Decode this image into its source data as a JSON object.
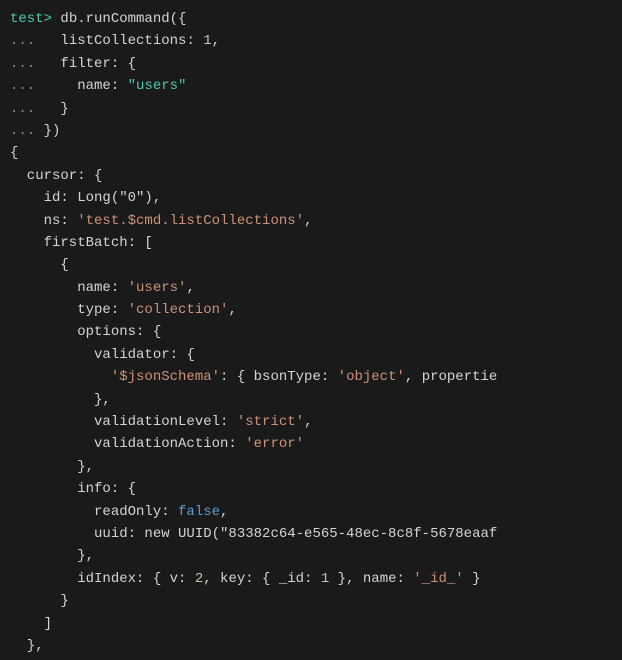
{
  "terminal": {
    "lines": [
      {
        "id": "line1",
        "parts": [
          {
            "text": "test> ",
            "color": "c-green"
          },
          {
            "text": "db.runCommand({",
            "color": "c-white"
          }
        ]
      },
      {
        "id": "line2",
        "parts": [
          {
            "text": "...   ",
            "color": "c-gray"
          },
          {
            "text": "listCollections: ",
            "color": "c-white"
          },
          {
            "text": "1",
            "color": "c-number"
          },
          {
            "text": ",",
            "color": "c-white"
          }
        ]
      },
      {
        "id": "line3",
        "parts": [
          {
            "text": "...   ",
            "color": "c-gray"
          },
          {
            "text": "filter: {",
            "color": "c-white"
          }
        ]
      },
      {
        "id": "line4",
        "parts": [
          {
            "text": "...     ",
            "color": "c-gray"
          },
          {
            "text": "name: ",
            "color": "c-white"
          },
          {
            "text": "\"users\"",
            "color": "c-green"
          }
        ]
      },
      {
        "id": "line5",
        "parts": [
          {
            "text": "...   ",
            "color": "c-gray"
          },
          {
            "text": "}",
            "color": "c-white"
          }
        ]
      },
      {
        "id": "line6",
        "parts": [
          {
            "text": "... ",
            "color": "c-gray"
          },
          {
            "text": "})",
            "color": "c-white"
          }
        ]
      },
      {
        "id": "line7",
        "parts": [
          {
            "text": "{",
            "color": "c-white"
          }
        ]
      },
      {
        "id": "line8",
        "parts": [
          {
            "text": "  cursor: {",
            "color": "c-white"
          }
        ]
      },
      {
        "id": "line9",
        "parts": [
          {
            "text": "    id: ",
            "color": "c-white"
          },
          {
            "text": "Long(\"0\")",
            "color": "c-white"
          },
          {
            "text": ",",
            "color": "c-white"
          }
        ]
      },
      {
        "id": "line10",
        "parts": [
          {
            "text": "    ns: ",
            "color": "c-white"
          },
          {
            "text": "'test.$cmd.listCollections'",
            "color": "c-orange"
          },
          {
            "text": ",",
            "color": "c-white"
          }
        ]
      },
      {
        "id": "line11",
        "parts": [
          {
            "text": "    firstBatch: [",
            "color": "c-white"
          }
        ]
      },
      {
        "id": "line12",
        "parts": [
          {
            "text": "      {",
            "color": "c-white"
          }
        ]
      },
      {
        "id": "line13",
        "parts": [
          {
            "text": "        name: ",
            "color": "c-white"
          },
          {
            "text": "'users'",
            "color": "c-orange"
          },
          {
            "text": ",",
            "color": "c-white"
          }
        ]
      },
      {
        "id": "line14",
        "parts": [
          {
            "text": "        type: ",
            "color": "c-white"
          },
          {
            "text": "'collection'",
            "color": "c-orange"
          },
          {
            "text": ",",
            "color": "c-white"
          }
        ]
      },
      {
        "id": "line15",
        "parts": [
          {
            "text": "        options: {",
            "color": "c-white"
          }
        ]
      },
      {
        "id": "line16",
        "parts": [
          {
            "text": "          validator: {",
            "color": "c-white"
          }
        ]
      },
      {
        "id": "line17",
        "parts": [
          {
            "text": "            '$jsonSchema'",
            "color": "c-orange"
          },
          {
            "text": ": { bsonType: ",
            "color": "c-white"
          },
          {
            "text": "'object'",
            "color": "c-orange"
          },
          {
            "text": ", propertie",
            "color": "c-white"
          }
        ]
      },
      {
        "id": "line18",
        "parts": [
          {
            "text": "          },",
            "color": "c-white"
          }
        ]
      },
      {
        "id": "line19",
        "parts": [
          {
            "text": "          validationLevel: ",
            "color": "c-white"
          },
          {
            "text": "'strict'",
            "color": "c-orange"
          },
          {
            "text": ",",
            "color": "c-white"
          }
        ]
      },
      {
        "id": "line20",
        "parts": [
          {
            "text": "          validationAction: ",
            "color": "c-white"
          },
          {
            "text": "'error'",
            "color": "c-orange"
          }
        ]
      },
      {
        "id": "line21",
        "parts": [
          {
            "text": "        },",
            "color": "c-white"
          }
        ]
      },
      {
        "id": "line22",
        "parts": [
          {
            "text": "        info: {",
            "color": "c-white"
          }
        ]
      },
      {
        "id": "line23",
        "parts": [
          {
            "text": "          readOnly: ",
            "color": "c-white"
          },
          {
            "text": "false",
            "color": "c-keyword"
          },
          {
            "text": ",",
            "color": "c-white"
          }
        ]
      },
      {
        "id": "line24",
        "parts": [
          {
            "text": "          uuid: ",
            "color": "c-white"
          },
          {
            "text": "new UUID(\"83382c64-e565-48ec-8c8f-5678eaaf",
            "color": "c-white"
          }
        ]
      },
      {
        "id": "line25",
        "parts": [
          {
            "text": "        },",
            "color": "c-white"
          }
        ]
      },
      {
        "id": "line26",
        "parts": [
          {
            "text": "        idIndex: { v: ",
            "color": "c-white"
          },
          {
            "text": "2",
            "color": "c-number"
          },
          {
            "text": ", key: { _id: ",
            "color": "c-white"
          },
          {
            "text": "1",
            "color": "c-number"
          },
          {
            "text": " }, name: ",
            "color": "c-white"
          },
          {
            "text": "'_id_'",
            "color": "c-orange"
          },
          {
            "text": " }",
            "color": "c-white"
          }
        ]
      },
      {
        "id": "line27",
        "parts": [
          {
            "text": "      }",
            "color": "c-white"
          }
        ]
      },
      {
        "id": "line28",
        "parts": [
          {
            "text": "    ]",
            "color": "c-white"
          }
        ]
      },
      {
        "id": "line29",
        "parts": [
          {
            "text": "  },",
            "color": "c-white"
          }
        ]
      }
    ]
  }
}
